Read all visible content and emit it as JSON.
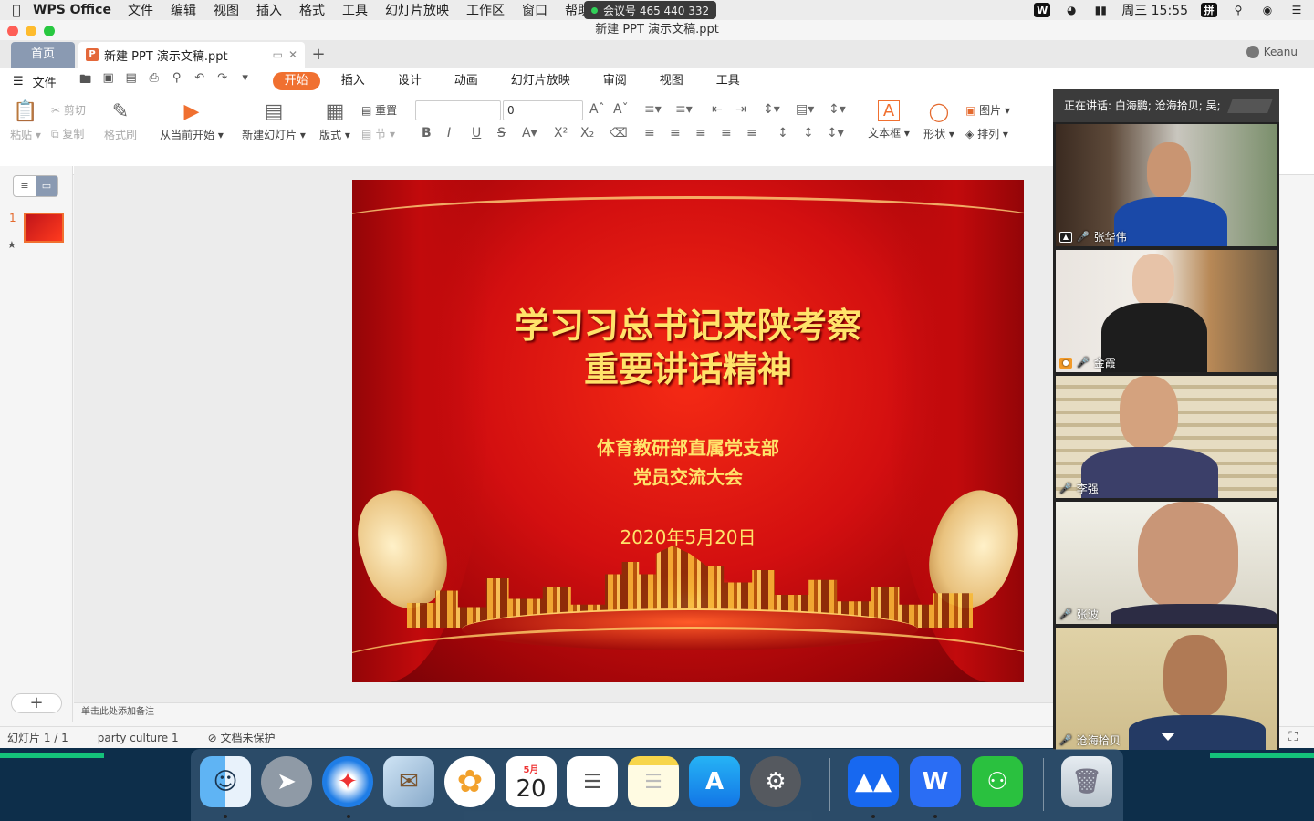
{
  "menubar": {
    "app_name": "WPS Office",
    "items": [
      "文件",
      "编辑",
      "视图",
      "插入",
      "格式",
      "工具",
      "幻灯片放映",
      "工作区",
      "窗口",
      "帮助"
    ],
    "meeting_label": "会议号 465 440 332",
    "clock": "周三 15:55",
    "input_method": "拼"
  },
  "window": {
    "title": "新建 PPT 演示文稿.ppt",
    "tabs": {
      "home": "首页",
      "doc": "新建 PPT 演示文稿.ppt",
      "add": "+"
    },
    "user": "Keanu",
    "file_menu": "文件",
    "ribbon_tabs": [
      "开始",
      "插入",
      "设计",
      "动画",
      "幻灯片放映",
      "审阅",
      "视图",
      "工具"
    ],
    "active_tab": "开始"
  },
  "ribbon": {
    "paste": "粘贴",
    "cut": "剪切",
    "copy": "复制",
    "format_painter": "格式刷",
    "from_current": "从当前开始",
    "new_slide": "新建幻灯片",
    "layout": "版式",
    "reset": "重置",
    "section": "节",
    "font_size": "0",
    "textbox": "文本框",
    "shape": "形状",
    "picture": "图片",
    "arrange": "排列"
  },
  "slides_panel": {
    "slide_number": "1",
    "add": "+"
  },
  "slide": {
    "title_line1": "学习习总书记来陕考察",
    "title_line2": "重要讲话精神",
    "sub_line1": "体育教研部直属党支部",
    "sub_line2": "党员交流大会",
    "date": "2020年5月20日"
  },
  "notes_placeholder": "单击此处添加备注",
  "status": {
    "slide_counter": "幻灯片 1 / 1",
    "theme": "party culture 1",
    "protection": "文档未保护"
  },
  "video_conference": {
    "speaking": "正在讲话: 白海鹏; 沧海拾贝; 吴;",
    "participants": [
      {
        "name": "张华伟"
      },
      {
        "name": "金霞"
      },
      {
        "name": "李强"
      },
      {
        "name": "张波"
      },
      {
        "name": "沧海拾贝"
      }
    ]
  },
  "dock": {
    "calendar_month": "5月",
    "calendar_day": "20"
  },
  "colors": {
    "accent": "#f07030",
    "slide_text": "#ffe36a",
    "slide_red": "#d30f10",
    "desktop_green": "#14c27a"
  }
}
